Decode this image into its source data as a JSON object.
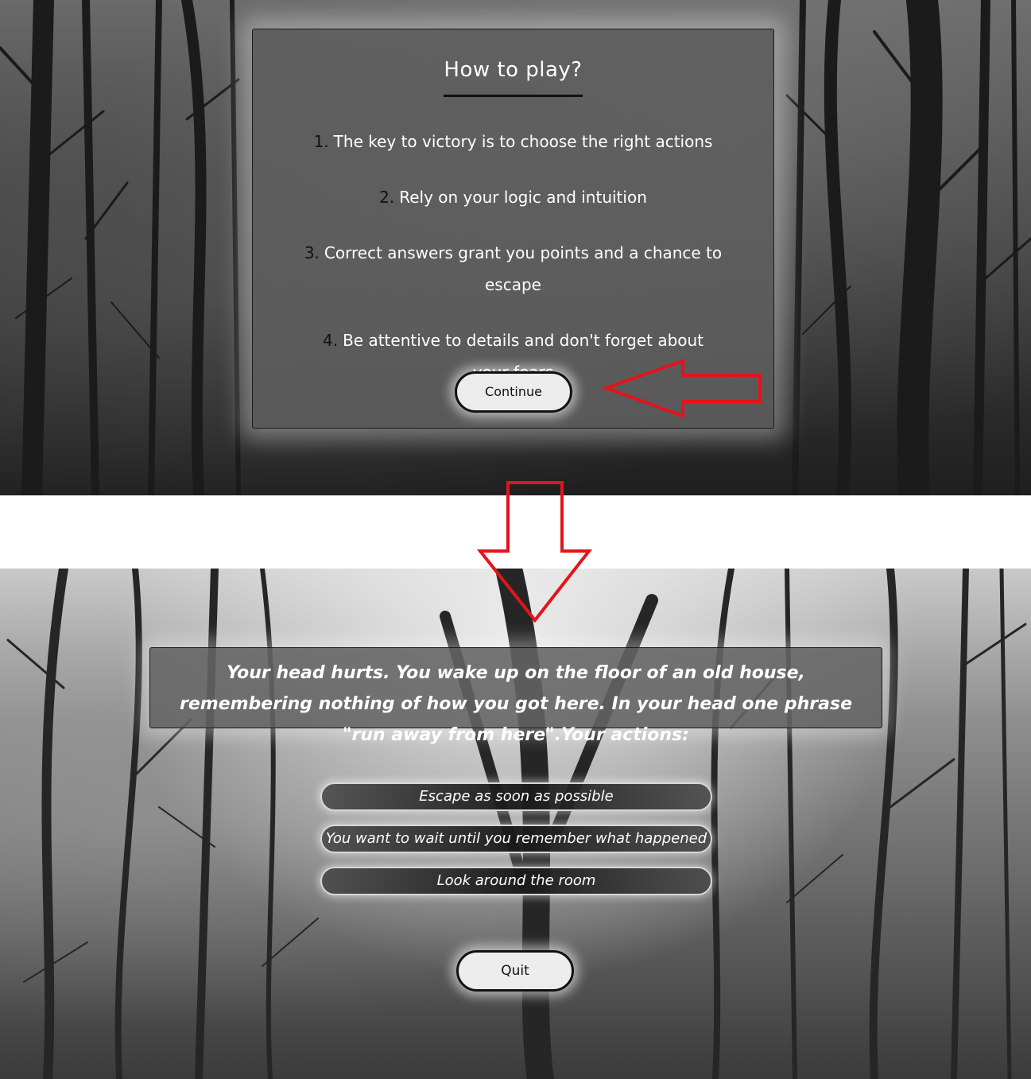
{
  "howto": {
    "title": "How to play?",
    "rules": [
      {
        "num": "1.",
        "text": "The key to victory is to choose the right actions"
      },
      {
        "num": "2.",
        "text": "Rely on your logic and intuition"
      },
      {
        "num": "3.",
        "text": "Correct answers grant you points and a chance to escape"
      },
      {
        "num": "4.",
        "text": "Be attentive to details and don't forget about your fears"
      }
    ],
    "continue_label": "Continue"
  },
  "game": {
    "story": "Your head hurts. You wake up on the floor of an old house, remembering nothing of how you got here. In your head one phrase \"run away from here\".Your actions:",
    "options": [
      "Escape as soon as possible",
      "You want to wait until you remember what happened",
      "Look around the room"
    ],
    "quit_label": "Quit"
  },
  "colors": {
    "annotation_arrow": "#e3141b",
    "panel": "#5f5f5f",
    "button_fill": "#ececec"
  }
}
